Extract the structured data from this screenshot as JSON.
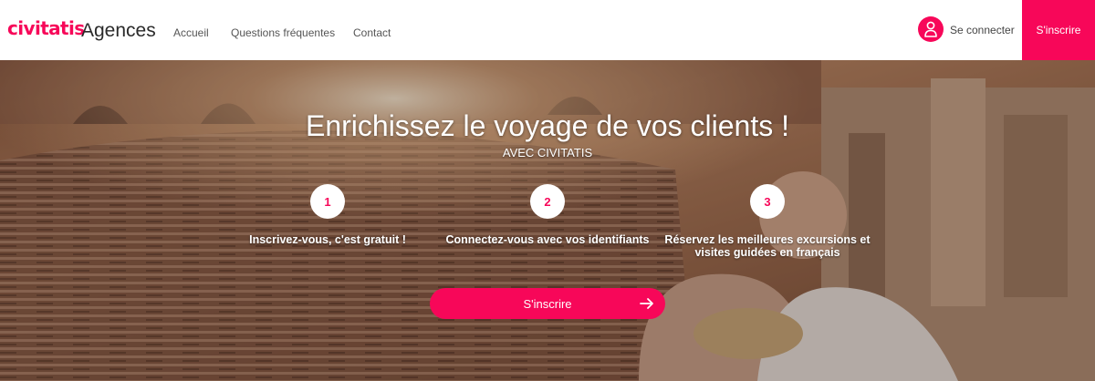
{
  "header": {
    "logo": "civitatis",
    "brand_sub": "Agences",
    "nav": [
      "Accueil",
      "Questions fréquentes",
      "Contact"
    ],
    "login": "Se connecter",
    "signup": "S'inscrire"
  },
  "hero": {
    "title": "Enrichissez le voyage de vos clients !",
    "subtitle": "AVEC CIVITATIS",
    "steps": [
      {
        "number": "1",
        "text": "Inscrivez-vous, c'est gratuit !"
      },
      {
        "number": "2",
        "text": "Connectez-vous avec vos identifiants"
      },
      {
        "number": "3",
        "text": "Réservez les meilleures excursions et visites guidées en français"
      }
    ],
    "cta": "S'inscrire"
  },
  "colors": {
    "brand": "#f70759",
    "nav_text": "#555555"
  },
  "icons": {
    "user": "user-icon",
    "arrow": "arrow-right-icon"
  }
}
